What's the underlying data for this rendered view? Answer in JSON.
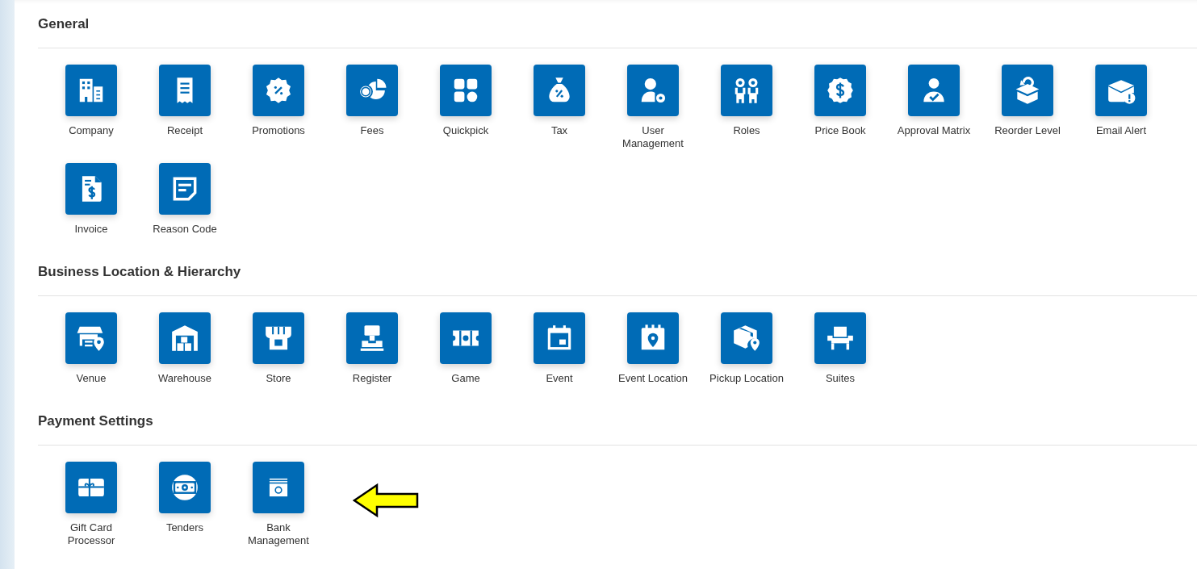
{
  "sections": [
    {
      "title": "General",
      "items": [
        {
          "label": "Company"
        },
        {
          "label": "Receipt"
        },
        {
          "label": "Promotions"
        },
        {
          "label": "Fees"
        },
        {
          "label": "Quickpick"
        },
        {
          "label": "Tax"
        },
        {
          "label": "User Management"
        },
        {
          "label": "Roles"
        },
        {
          "label": "Price Book"
        },
        {
          "label": "Approval Matrix"
        },
        {
          "label": "Reorder Level"
        },
        {
          "label": "Email Alert"
        },
        {
          "label": "Invoice"
        },
        {
          "label": "Reason Code"
        }
      ]
    },
    {
      "title": "Business Location & Hierarchy",
      "items": [
        {
          "label": "Venue"
        },
        {
          "label": "Warehouse"
        },
        {
          "label": "Store"
        },
        {
          "label": "Register"
        },
        {
          "label": "Game"
        },
        {
          "label": "Event"
        },
        {
          "label": "Event Location"
        },
        {
          "label": "Pickup Location"
        },
        {
          "label": "Suites"
        }
      ]
    },
    {
      "title": "Payment Settings",
      "items": [
        {
          "label": "Gift Card Processor"
        },
        {
          "label": "Tenders"
        },
        {
          "label": "Bank Management"
        }
      ]
    }
  ]
}
